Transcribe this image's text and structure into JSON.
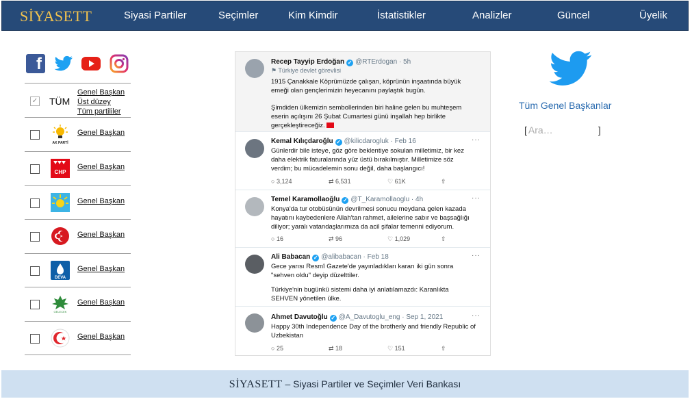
{
  "header": {
    "logo": "SİYASETT",
    "nav": [
      "Siyasi Partiler",
      "Seçimler",
      "Kim Kimdir",
      "İstatistikler",
      "Analizler",
      "Güncel",
      "Üyelik"
    ]
  },
  "social": {
    "facebook": "f"
  },
  "party_list": {
    "all_label": "TÜM",
    "all_links": [
      "Genel Başkan",
      "Üst düzey",
      "Tüm partililer"
    ],
    "rows": [
      {
        "party": "AK PARTİ",
        "link": "Genel Başkan"
      },
      {
        "party": "CHP",
        "link": "Genel Başkan"
      },
      {
        "party": "İYİ Parti",
        "link": "Genel Başkan"
      },
      {
        "party": "MHP",
        "link": "Genel Başkan"
      },
      {
        "party": "DEVA",
        "link": "Genel Başkan"
      },
      {
        "party": "Gelecek Partisi",
        "link": "Genel Başkan"
      },
      {
        "party": "Saadet Partisi",
        "link": "Genel Başkan"
      }
    ],
    "logo_text": {
      "akp": "AK PARTİ",
      "chp": "CHP",
      "deva": "DEVA",
      "gelecek": "GELECEK"
    }
  },
  "feed": {
    "tweets": [
      {
        "name": "Recep Tayyip Erdoğan",
        "handle": "@RTErdogan · 5h",
        "label": "⚑ Türkiye devlet görevlisi",
        "text": "1915 Çanakkale Köprümüzde çalışan, köprünün inşaatında büyük emeği olan gençlerimizin heyecanını paylaştık bugün.",
        "text2": "Şimdiden ülkemizin sembollerinden biri haline gelen bu muhteşem eserin açılışını 26 Şubat Cumartesi günü inşallah hep birlikte gerçekleştireceğiz."
      },
      {
        "name": "Kemal Kılıçdaroğlu",
        "handle": "@kilicdarogluk · Feb 16",
        "text": "Günlerdir bile isteye, göz göre beklentiye sokulan milletimiz, bir kez daha elektrik faturalarında yüz üstü bırakılmıştır. Milletimize söz verdim; bu mücadelemin sonu değil, daha başlangıcı!",
        "replies": "3,124",
        "retweets": "6,531",
        "likes": "61K"
      },
      {
        "name": "Temel Karamollaoğlu",
        "handle": "@T_Karamollaoglu · 4h",
        "text": "Konya'da tur otobüsünün devrilmesi sonucu meydana gelen kazada hayatını kaybedenlere Allah'tan rahmet, ailelerine sabır ve başsağlığı diliyor; yaralı vatandaşlarımıza da acil şifalar temenni ediyorum.",
        "replies": "16",
        "retweets": "96",
        "likes": "1,029"
      },
      {
        "name": "Ali Babacan",
        "handle": "@alibabacan · Feb 18",
        "text": "Gece yarısı Resmî Gazete'de yayınladıkları kararı iki gün sonra \"sehven oldu\" deyip düzelttiler.",
        "text2": "Türkiye'nin bugünkü sistemi daha iyi anlatılamazdı: Karanlıkta SEHVEN yönetilen ülke."
      },
      {
        "name": "Ahmet Davutoğlu",
        "handle": "@A_Davutoglu_eng · Sep 1, 2021",
        "text": "Happy 30th Independence Day of the brotherly and friendly Republic of Uzbekistan",
        "replies": "25",
        "retweets": "18",
        "likes": "151"
      }
    ]
  },
  "right_panel": {
    "title": "Tüm Genel Başkanlar",
    "search_placeholder": "Ara…",
    "bracket_open": "[",
    "bracket_close": "]"
  },
  "footer": {
    "brand": "SİYASETT",
    "text": " – Siyasi Partiler ve Seçimler Veri Bankası"
  },
  "colors": {
    "nav_bg": "#264a78",
    "logo": "#f3c34e",
    "twitter": "#1da1f2",
    "footer_bg": "#cfe0f1"
  }
}
